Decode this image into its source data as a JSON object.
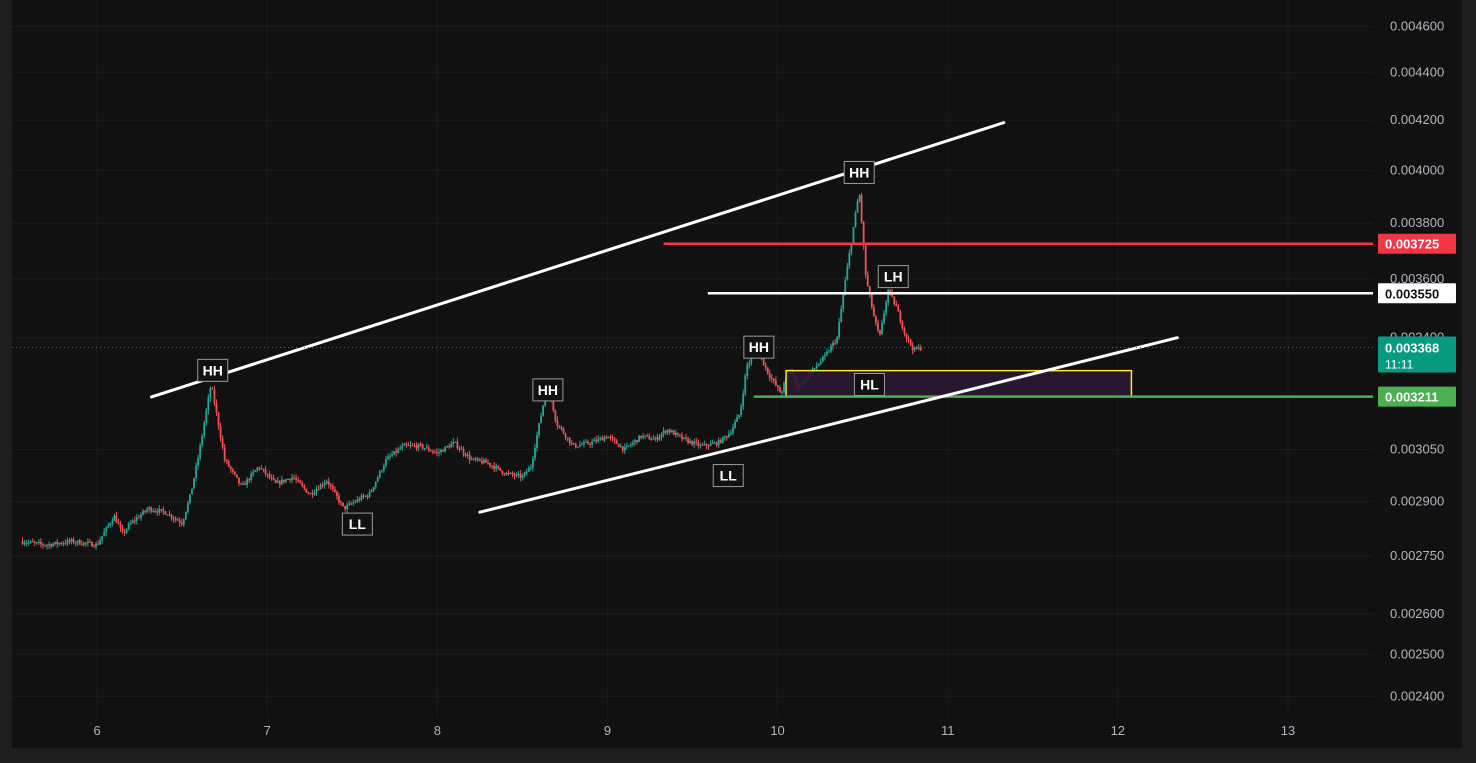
{
  "chart_data": {
    "type": "candlestick",
    "y_axis": {
      "scale": "log",
      "range": [
        0.00235,
        0.00472
      ],
      "tick_labels": [
        "0.004600",
        "0.004400",
        "0.004200",
        "0.004000",
        "0.003800",
        "0.003600",
        "0.003400",
        "0.003050",
        "0.002900",
        "0.002750",
        "0.002600",
        "0.002500",
        "0.002400"
      ]
    },
    "x_axis": {
      "range": [
        5.5,
        13.5
      ],
      "tick_labels": [
        "6",
        "7",
        "8",
        "9",
        "10",
        "11",
        "12",
        "13"
      ]
    },
    "grid": true,
    "price_path": [
      [
        5.55,
        0.00279
      ],
      [
        5.7,
        0.00278
      ],
      [
        5.85,
        0.00279
      ],
      [
        6.0,
        0.00278
      ],
      [
        6.05,
        0.00282
      ],
      [
        6.1,
        0.00286
      ],
      [
        6.15,
        0.00281
      ],
      [
        6.2,
        0.00284
      ],
      [
        6.3,
        0.00288
      ],
      [
        6.4,
        0.00287
      ],
      [
        6.5,
        0.00284
      ],
      [
        6.55,
        0.00292
      ],
      [
        6.6,
        0.00304
      ],
      [
        6.67,
        0.00325
      ],
      [
        6.75,
        0.00302
      ],
      [
        6.85,
        0.00294
      ],
      [
        6.95,
        0.003
      ],
      [
        7.05,
        0.00295
      ],
      [
        7.15,
        0.00297
      ],
      [
        7.25,
        0.00292
      ],
      [
        7.35,
        0.00296
      ],
      [
        7.45,
        0.00288
      ],
      [
        7.55,
        0.00291
      ],
      [
        7.6,
        0.00292
      ],
      [
        7.7,
        0.00302
      ],
      [
        7.8,
        0.00306
      ],
      [
        7.9,
        0.00306
      ],
      [
        8.0,
        0.00304
      ],
      [
        8.1,
        0.00307
      ],
      [
        8.2,
        0.00302
      ],
      [
        8.3,
        0.00301
      ],
      [
        8.4,
        0.00298
      ],
      [
        8.5,
        0.00297
      ],
      [
        8.55,
        0.003
      ],
      [
        8.62,
        0.00318
      ],
      [
        8.65,
        0.00325
      ],
      [
        8.7,
        0.00313
      ],
      [
        8.8,
        0.00306
      ],
      [
        8.9,
        0.00307
      ],
      [
        9.0,
        0.00309
      ],
      [
        9.1,
        0.00305
      ],
      [
        9.2,
        0.00309
      ],
      [
        9.28,
        0.00308
      ],
      [
        9.35,
        0.00311
      ],
      [
        9.45,
        0.00308
      ],
      [
        9.55,
        0.00306
      ],
      [
        9.65,
        0.00307
      ],
      [
        9.72,
        0.0031
      ],
      [
        9.78,
        0.00316
      ],
      [
        9.82,
        0.00331
      ],
      [
        9.88,
        0.00336
      ],
      [
        9.95,
        0.00328
      ],
      [
        10.02,
        0.00322
      ],
      [
        10.07,
        0.0033
      ],
      [
        10.12,
        0.00324
      ],
      [
        10.2,
        0.00329
      ],
      [
        10.28,
        0.00334
      ],
      [
        10.35,
        0.0034
      ],
      [
        10.42,
        0.00368
      ],
      [
        10.48,
        0.00392
      ],
      [
        10.52,
        0.0036
      ],
      [
        10.57,
        0.00346
      ],
      [
        10.6,
        0.0034
      ],
      [
        10.65,
        0.00356
      ],
      [
        10.7,
        0.0035
      ],
      [
        10.75,
        0.00341
      ],
      [
        10.8,
        0.00336
      ],
      [
        10.85,
        0.003368
      ]
    ],
    "trendlines": [
      {
        "from": [
          6.32,
          0.00321
        ],
        "to": [
          11.33,
          0.00419
        ],
        "color": "#ffffff"
      },
      {
        "from": [
          8.25,
          0.00287
        ],
        "to": [
          12.35,
          0.0034
        ],
        "color": "#ffffff"
      }
    ],
    "horizontal_levels": [
      {
        "value": 0.003725,
        "from_x": 9.33,
        "color": "#f23645",
        "label": "0.003725"
      },
      {
        "value": 0.00355,
        "from_x": 9.59,
        "color": "#ffffff",
        "label": "0.003550"
      },
      {
        "value": 0.003211,
        "from_x": 9.86,
        "color": "#4caf50",
        "label": "0.003211"
      }
    ],
    "zone": {
      "x": [
        10.05,
        12.08
      ],
      "y": [
        0.003212,
        0.003293
      ],
      "fill": "#2a1a33",
      "border": "#ffe43a"
    },
    "last_price": {
      "value": 0.003368,
      "label": "0.003368",
      "countdown": "11:11",
      "color": "#089981"
    },
    "annotations": [
      {
        "text": "HH",
        "x": 6.68,
        "y": 0.003294
      },
      {
        "text": "LL",
        "x": 7.53,
        "y": 0.002837
      },
      {
        "text": "HH",
        "x": 8.65,
        "y": 0.003232
      },
      {
        "text": "LL",
        "x": 9.71,
        "y": 0.002974
      },
      {
        "text": "HH",
        "x": 9.89,
        "y": 0.003369
      },
      {
        "text": "HH",
        "x": 10.48,
        "y": 0.003992
      },
      {
        "text": "LH",
        "x": 10.68,
        "y": 0.003608
      },
      {
        "text": "HL",
        "x": 10.54,
        "y": 0.003249
      }
    ],
    "colors": {
      "up": "#26a69a",
      "down": "#ef5350",
      "background": "#111111",
      "grid": "#1c1c1c",
      "text": "#b2b5be"
    }
  }
}
